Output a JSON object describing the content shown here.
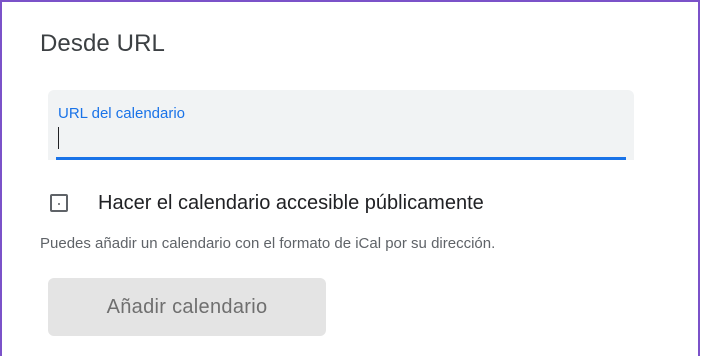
{
  "dialog": {
    "title": "Desde URL",
    "url_field": {
      "label": "URL del calendario",
      "value": "",
      "placeholder": ""
    },
    "public_checkbox": {
      "label": "Hacer el calendario accesible públicamente",
      "checked": false
    },
    "help_text": "Puedes añadir un calendario con el formato de iCal por su dirección.",
    "add_button_label": "Añadir calendario",
    "add_button_disabled": true
  },
  "colors": {
    "accent": "#1a73e8",
    "frame_border": "#7b52c9",
    "field_background": "#f1f3f4",
    "disabled_button_bg": "#e4e4e4",
    "disabled_button_text": "#6f6f6f"
  },
  "icons": {
    "checkbox": "checkbox-unchecked-icon"
  }
}
